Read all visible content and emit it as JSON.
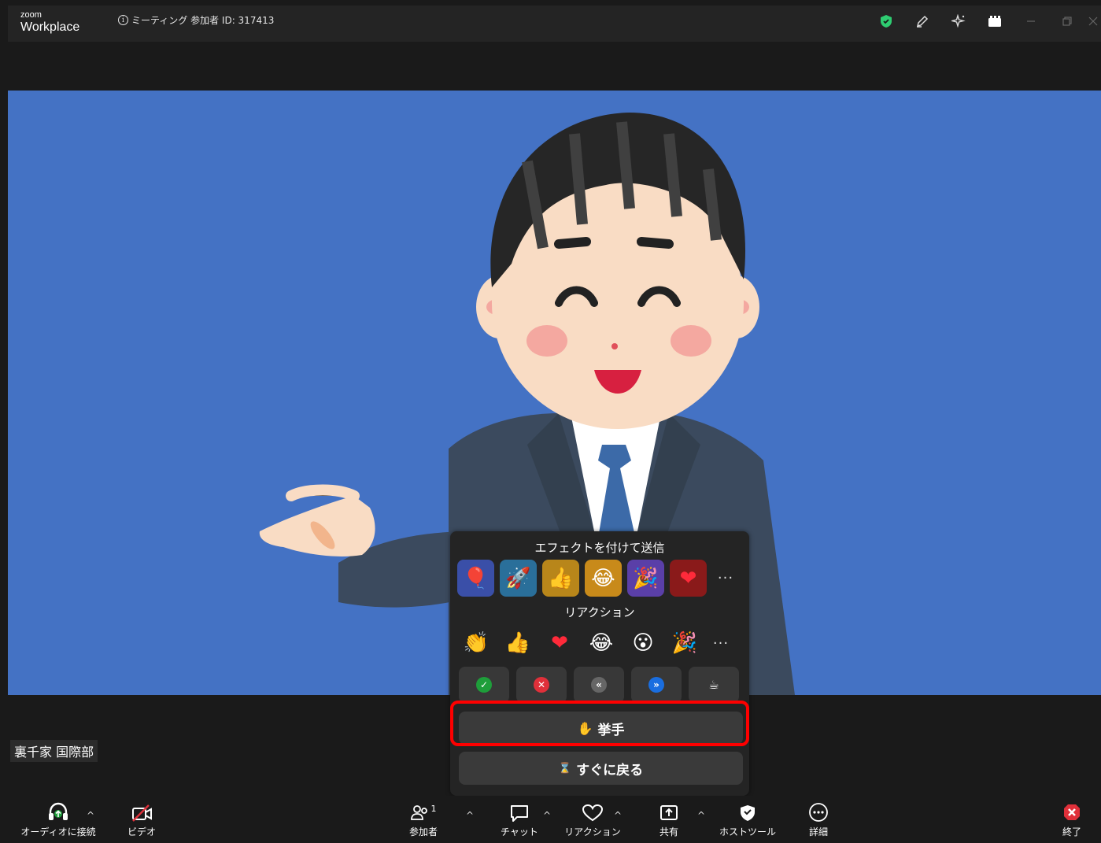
{
  "titlebar": {
    "logo_small": "zoom",
    "logo_big": "Workplace",
    "meeting_info": "ミーティング 参加者 ID: 317413"
  },
  "video": {
    "name_tag": "裏千家 国際部"
  },
  "reactions_popup": {
    "effects_title": "エフェクトを付けて送信",
    "effects": [
      {
        "icon": "balloon-icon",
        "glyph": "🎈",
        "bg": "#3a4fa8"
      },
      {
        "icon": "rocket-icon",
        "glyph": "🚀",
        "bg": "#2a6f9a"
      },
      {
        "icon": "thumbs-up-icon",
        "glyph": "👍",
        "bg": "#b8861a"
      },
      {
        "icon": "laughing-icon",
        "glyph": "😂",
        "bg": "#c88a1a"
      },
      {
        "icon": "party-popper-icon",
        "glyph": "🎉",
        "bg": "#5a3fa8"
      },
      {
        "icon": "heart-icon",
        "glyph": "❤",
        "bg": "#8a1a1a"
      }
    ],
    "more_label": "···",
    "reactions_title": "リアクション",
    "reactions": [
      {
        "icon": "clapping-hands-icon",
        "glyph": "👏"
      },
      {
        "icon": "thumbs-up-icon",
        "glyph": "👍"
      },
      {
        "icon": "heart-icon",
        "glyph": "❤"
      },
      {
        "icon": "laughing-icon",
        "glyph": "😂"
      },
      {
        "icon": "surprised-face-icon",
        "glyph": "😮"
      },
      {
        "icon": "party-popper-icon",
        "glyph": "🎉"
      }
    ],
    "status_buttons": [
      {
        "icon": "check-icon",
        "glyph": "✓",
        "color": "#1e9e3a"
      },
      {
        "icon": "cross-icon",
        "glyph": "✕",
        "color": "#e0303a"
      },
      {
        "icon": "slower-icon",
        "glyph": "«",
        "color": "#666666"
      },
      {
        "icon": "faster-icon",
        "glyph": "»",
        "color": "#1a6ee0"
      },
      {
        "icon": "coffee-icon",
        "glyph": "☕",
        "color": "transparent"
      }
    ],
    "raise_hand_icon": "✋",
    "raise_hand_label": "挙手",
    "be_right_back_icon": "⌛",
    "be_right_back_label": "すぐに戻る"
  },
  "toolbar": {
    "audio_label": "オーディオに接続",
    "video_label": "ビデオ",
    "participants_label": "参加者",
    "participants_count": "1",
    "chat_label": "チャット",
    "reactions_label": "リアクション",
    "share_label": "共有",
    "host_tools_label": "ホストツール",
    "more_label": "詳細",
    "end_label": "終了"
  },
  "colors": {
    "video_bg": "#4472c4",
    "highlight": "#ff0000",
    "shield_green": "#2ecc71",
    "end_red": "#e0303a"
  }
}
